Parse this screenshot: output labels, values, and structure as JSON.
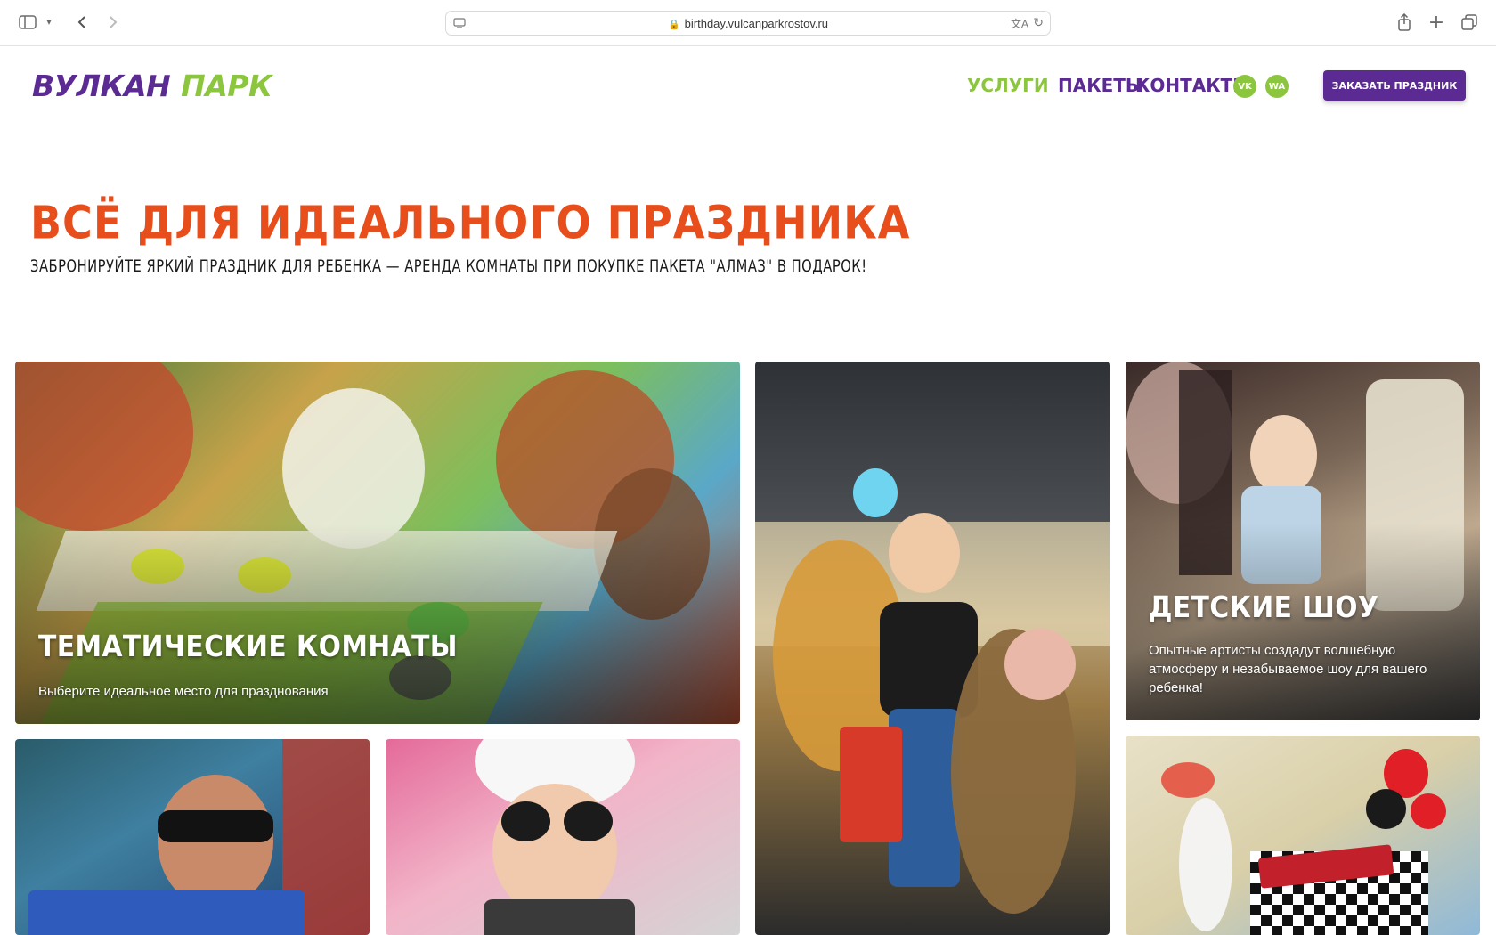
{
  "browser": {
    "url": "birthday.vulcanparkrostov.ru"
  },
  "header": {
    "logo": {
      "word1": "ВУЛКАН",
      "word2": "ПАРК"
    },
    "nav": [
      {
        "label": "УСЛУГИ",
        "active": true
      },
      {
        "label": "ПАКЕТЫ",
        "active": false
      },
      {
        "label": "КОНТАКТЫ",
        "active": false
      }
    ],
    "social": [
      {
        "icon": "vk-icon",
        "label": "VK"
      },
      {
        "icon": "whatsapp-icon",
        "label": "WA"
      }
    ],
    "cta_label": "ЗАКАЗАТЬ ПРАЗДНИК"
  },
  "hero": {
    "title": "ВСЁ ДЛЯ ИДЕАЛЬНОГО ПРАЗДНИКА",
    "subtitle": "ЗАБРОНИРУЙТЕ ЯРКИЙ ПРАЗДНИК ДЛЯ РЕБЕНКА — АРЕНДА КОМНАТЫ ПРИ ПОКУПКЕ ПАКЕТА \"АЛМАЗ\" В ПОДАРОК!"
  },
  "cards": {
    "rooms": {
      "title": "ТЕМАТИЧЕСКИЕ КОМНАТЫ",
      "desc": "Выберите идеальное место для празднования"
    },
    "shows": {
      "title": "ДЕТСКИЕ ШОУ",
      "desc": "Опытные артисты создадут волшебную атмосферу и незабываемое шоу для вашего ребенка!"
    }
  },
  "colors": {
    "brand_purple": "#5b2a93",
    "brand_green": "#8cc63f",
    "hero_orange": "#e84e1b"
  }
}
